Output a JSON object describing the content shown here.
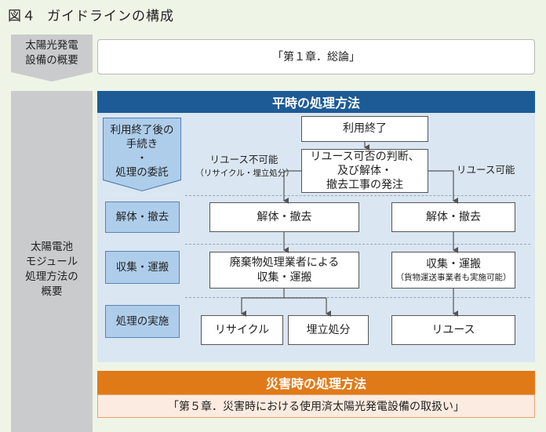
{
  "title": {
    "fig": "図４",
    "text": "ガイドラインの構成"
  },
  "left": {
    "overview": "太陽光発電\n設備の概要",
    "module": "太陽電池\nモジュール\n処理方法の\n概要"
  },
  "chapter1": "「第１章．総論」",
  "normal": {
    "header": "平時の処理方法",
    "steps": {
      "procedure": "利用終了後の\n手続き\n・\n処理の委託",
      "dismantle": "解体・撤去",
      "collect": "収集・運搬",
      "process": "処理の実施"
    },
    "boxes": {
      "end_of_use": "利用終了",
      "judgement": "リユース可否の判断、\n及び解体・\n撤去工事の発注",
      "dismantle_left": "解体・撤去",
      "dismantle_right": "解体・撤去",
      "collect_left": "廃棄物処理業者による\n収集・運搬",
      "collect_right": "収集・運搬",
      "collect_right_note": "（貨物運送事業者も実施可能）",
      "recycle": "リサイクル",
      "landfill": "埋立処分",
      "reuse": "リユース"
    },
    "labels": {
      "not_reusable": "リユース不可能",
      "not_reusable_note": "（リサイクル・埋立処分）",
      "reusable": "リユース可能"
    }
  },
  "disaster": {
    "header": "災害時の処理方法",
    "chapter5": "「第５章．災害時における使用済太陽光発電設備の取扱い」"
  }
}
